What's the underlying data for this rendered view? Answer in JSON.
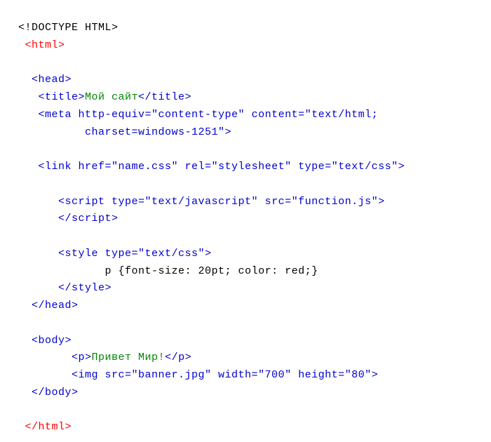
{
  "lines": [
    {
      "indent": 0,
      "parts": [
        {
          "t": "<!DOCTYPE HTML>",
          "c": "c-black"
        }
      ]
    },
    {
      "indent": 1,
      "parts": [
        {
          "t": "<html>",
          "c": "c-red"
        }
      ]
    },
    {
      "indent": 0,
      "parts": []
    },
    {
      "indent": 2,
      "parts": [
        {
          "t": "<head>",
          "c": "c-blue"
        }
      ]
    },
    {
      "indent": 3,
      "parts": [
        {
          "t": "<title>",
          "c": "c-blue"
        },
        {
          "t": "Мой сайт",
          "c": "c-green"
        },
        {
          "t": "</title>",
          "c": "c-blue"
        }
      ]
    },
    {
      "indent": 3,
      "parts": [
        {
          "t": "<meta http-equiv=\"content-type\" content=\"text/html;",
          "c": "c-blue"
        }
      ]
    },
    {
      "indent": 10,
      "parts": [
        {
          "t": "charset=windows-1251\">",
          "c": "c-blue"
        }
      ]
    },
    {
      "indent": 0,
      "parts": []
    },
    {
      "indent": 3,
      "parts": [
        {
          "t": "<link href=\"name.css\" rel=\"stylesheet\" type=\"text/css\">",
          "c": "c-blue"
        }
      ]
    },
    {
      "indent": 0,
      "parts": []
    },
    {
      "indent": 6,
      "parts": [
        {
          "t": "<script type=\"text/javascript\" src=\"function.js\">",
          "c": "c-blue"
        }
      ]
    },
    {
      "indent": 6,
      "parts": [
        {
          "t": "</scr",
          "c": "c-blue"
        },
        {
          "t": "ipt>",
          "c": "c-blue"
        }
      ]
    },
    {
      "indent": 0,
      "parts": []
    },
    {
      "indent": 6,
      "parts": [
        {
          "t": "<style type=\"text/css\">",
          "c": "c-blue"
        }
      ]
    },
    {
      "indent": 13,
      "parts": [
        {
          "t": "p {font-size: 20pt; color: red;}",
          "c": "c-black"
        }
      ]
    },
    {
      "indent": 6,
      "parts": [
        {
          "t": "</style>",
          "c": "c-blue"
        }
      ]
    },
    {
      "indent": 2,
      "parts": [
        {
          "t": "</head>",
          "c": "c-blue"
        }
      ]
    },
    {
      "indent": 0,
      "parts": []
    },
    {
      "indent": 2,
      "parts": [
        {
          "t": "<body>",
          "c": "c-blue"
        }
      ]
    },
    {
      "indent": 8,
      "parts": [
        {
          "t": "<p>",
          "c": "c-blue"
        },
        {
          "t": "Привет Мир!",
          "c": "c-green"
        },
        {
          "t": "</p>",
          "c": "c-blue"
        }
      ]
    },
    {
      "indent": 8,
      "parts": [
        {
          "t": "<img src=\"banner.jpg\" width=\"700\" height=\"80\">",
          "c": "c-blue"
        }
      ]
    },
    {
      "indent": 2,
      "parts": [
        {
          "t": "</body>",
          "c": "c-blue"
        }
      ]
    },
    {
      "indent": 0,
      "parts": []
    },
    {
      "indent": 1,
      "parts": [
        {
          "t": "</html>",
          "c": "c-red"
        }
      ]
    }
  ]
}
